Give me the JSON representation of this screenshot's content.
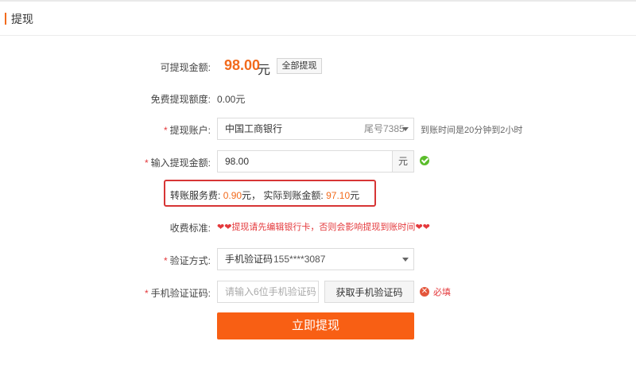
{
  "header": {
    "title": "提现"
  },
  "available": {
    "label": "可提现金额:",
    "amount": "98.00",
    "unit": "元",
    "withdraw_all": "全部提现"
  },
  "free_quota": {
    "label": "免费提现额度:",
    "value": "0.00元"
  },
  "account": {
    "required_mark": "*",
    "label": "提现账户:",
    "bank": "中国工商银行",
    "tail": "尾号7385",
    "arrival_note": "到账时间是20分钟到2小时"
  },
  "amount_input": {
    "required_mark": "*",
    "label": "输入提现金额:",
    "value": "98.00",
    "unit": "元"
  },
  "fee": {
    "label": "转账服务费:",
    "fee_value": "0.90",
    "fee_unit": "元，",
    "actual_label": "实际到账金额:",
    "actual_value": "97.10",
    "actual_unit": "元"
  },
  "standard": {
    "label": "收费标准:",
    "hearts_left": "❤❤",
    "text": "提现请先编辑银行卡，否则会影响提现到账时间",
    "hearts_right": "❤❤"
  },
  "verify": {
    "required_mark": "*",
    "label": "验证方式:",
    "method": "手机验证码",
    "phone": "155****3087"
  },
  "sms": {
    "required_mark": "*",
    "label": "手机验证证码:",
    "placeholder": "请输入6位手机验证码",
    "get_code": "获取手机验证码",
    "error_icon": "✕",
    "required_text": "必填"
  },
  "submit": {
    "label": "立即提现"
  },
  "colors": {
    "accent": "#f26b1d",
    "button": "#f85f14",
    "error": "#e4393c",
    "success": "#5bbd2b",
    "highlight_box": "#d73535"
  }
}
